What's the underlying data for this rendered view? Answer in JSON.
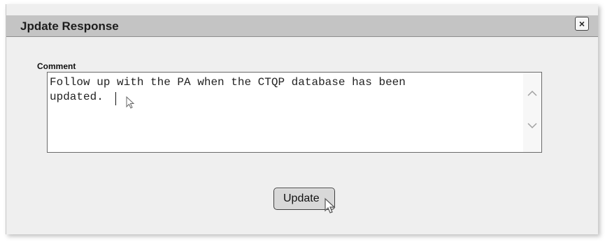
{
  "dialog": {
    "title": "Jpdate Response",
    "close_glyph": "×",
    "comment_label": "Comment",
    "comment_value": "Follow up with the PA when the CTQP database has been\nupdated.",
    "update_label": "Update"
  },
  "icons": {
    "close": "close-icon",
    "scroll_up": "chevron-up-icon",
    "scroll_down": "chevron-down-icon",
    "pointer": "arrow-cursor-icon",
    "hand": "hand-cursor-icon"
  },
  "colors": {
    "titlebar": "#c4c4c4",
    "dialog_bg": "#efefef",
    "button_bg": "#d8d8d8"
  }
}
